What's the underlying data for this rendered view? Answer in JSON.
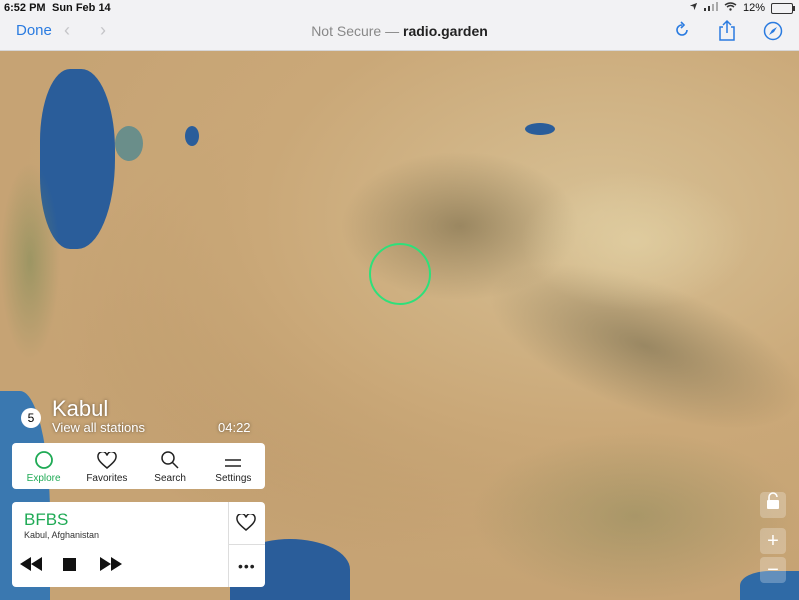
{
  "statusbar": {
    "time": "6:52 PM",
    "date": "Sun Feb 14",
    "battery": "12%",
    "battery_level": 0.12
  },
  "navbar": {
    "done": "Done",
    "prefix": "Not Secure —",
    "domain": "radio.garden"
  },
  "station": {
    "count": "5",
    "city": "Kabul",
    "view_all": "View all stations",
    "time": "04:22"
  },
  "tabs": [
    {
      "label": "Explore",
      "icon": "explore-circle-icon",
      "active": true
    },
    {
      "label": "Favorites",
      "icon": "heart-icon"
    },
    {
      "label": "Search",
      "icon": "search-icon"
    },
    {
      "label": "Settings",
      "icon": "settings-lines-icon"
    }
  ],
  "player": {
    "name": "BFBS",
    "location": "Kabul, Afghanistan",
    "more": "•••"
  },
  "map_controls": {
    "zoom_in": "+",
    "zoom_out": "−"
  },
  "colors": {
    "accent": "#1faa55",
    "ios_blue": "#2a7be0",
    "target": "#2ee07a"
  }
}
